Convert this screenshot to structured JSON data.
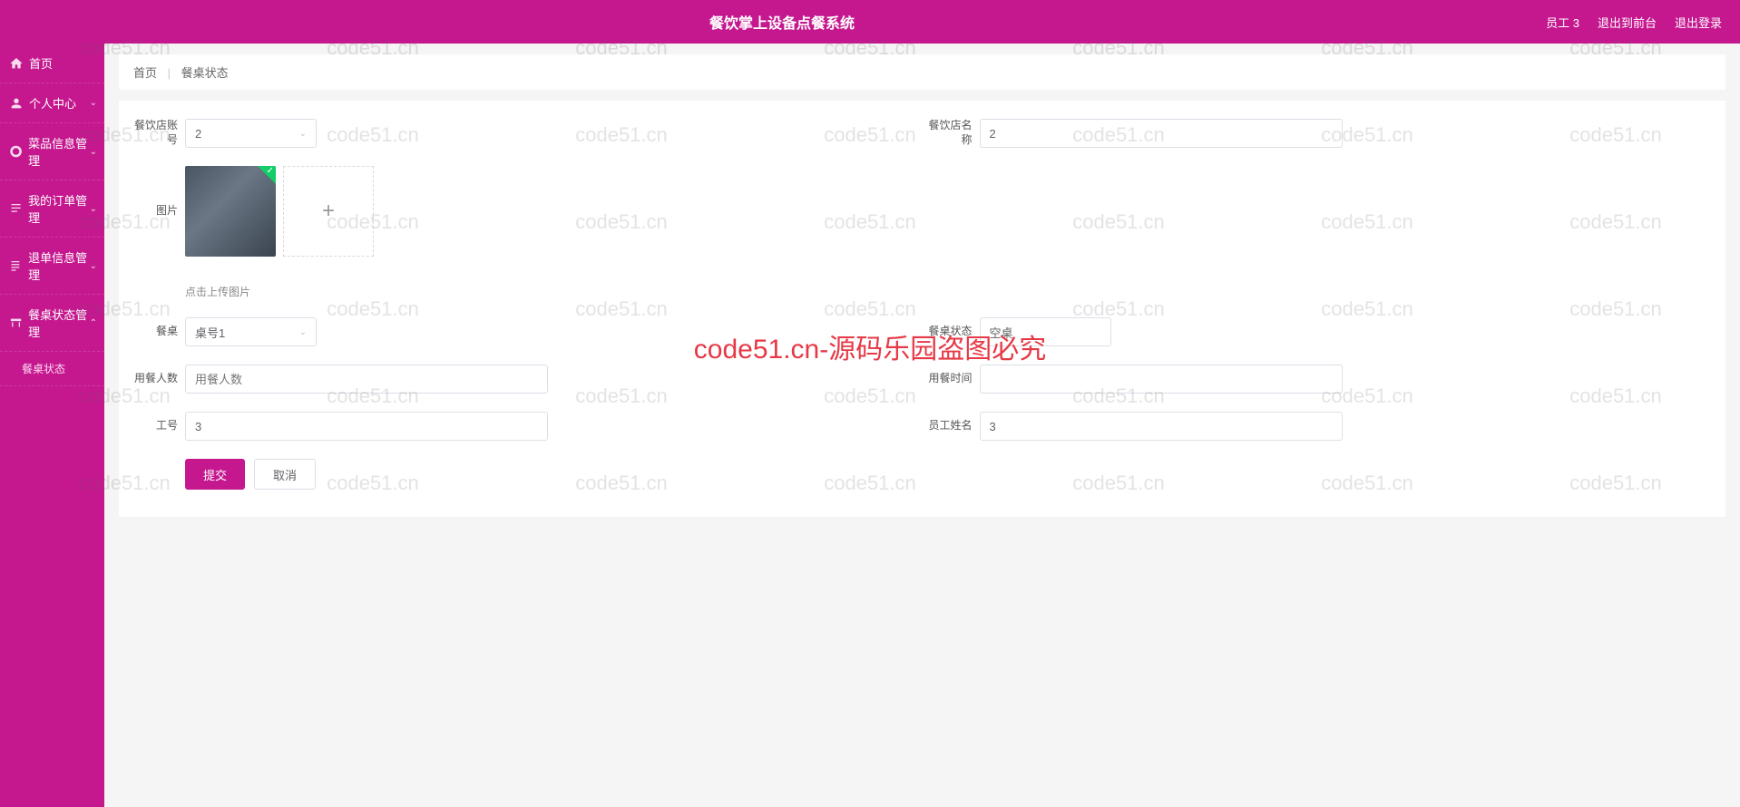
{
  "header": {
    "title": "餐饮掌上设备点餐系统",
    "user": "员工 3",
    "back_front": "退出到前台",
    "logout": "退出登录"
  },
  "sidebar": {
    "items": [
      {
        "label": "首页",
        "icon": "home"
      },
      {
        "label": "个人中心",
        "icon": "user",
        "expand": true
      },
      {
        "label": "菜品信息管理",
        "icon": "dish",
        "expand": true
      },
      {
        "label": "我的订单管理",
        "icon": "order",
        "expand": true
      },
      {
        "label": "退单信息管理",
        "icon": "refund",
        "expand": true
      },
      {
        "label": "餐桌状态管理",
        "icon": "table",
        "expand": true,
        "open": true
      }
    ],
    "sub": "餐桌状态"
  },
  "breadcrumb": {
    "home": "首页",
    "current": "餐桌状态"
  },
  "form": {
    "shop_account_label": "餐饮店账号",
    "shop_account_value": "2",
    "shop_name_label": "餐饮店名称",
    "shop_name_value": "2",
    "image_label": "图片",
    "image_hint": "点击上传图片",
    "table_label": "餐桌",
    "table_value": "桌号1",
    "status_label": "餐桌状态",
    "status_value": "空桌",
    "people_label": "用餐人数",
    "people_placeholder": "用餐人数",
    "order_time_label": "用餐时间",
    "emp_no_label": "工号",
    "emp_no_value": "3",
    "emp_name_label": "员工姓名",
    "emp_name_value": "3",
    "submit": "提交",
    "cancel": "取消"
  },
  "watermark": {
    "text": "code51.cn",
    "big": "code51.cn-源码乐园盗图必究"
  }
}
